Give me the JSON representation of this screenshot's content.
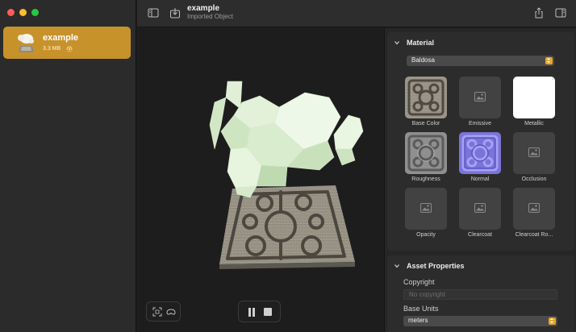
{
  "window": {
    "traffic_lights": [
      "close",
      "minimize",
      "zoom"
    ]
  },
  "sidebar": {
    "items": [
      {
        "name": "example",
        "size": "3.3 MB",
        "icon": "model-thumbnail-icon",
        "selected": true,
        "accent": "#c8922b"
      }
    ]
  },
  "toolbar": {
    "title": "example",
    "subtitle": "Imported Object",
    "icons": [
      "sidebar-toggle-icon",
      "import-icon",
      "share-icon",
      "inspector-toggle-icon"
    ]
  },
  "viewport": {
    "controls": [
      "frame-object-icon",
      "ar-headset-icon"
    ],
    "playback": [
      "pause-icon",
      "stop-icon"
    ]
  },
  "inspector": {
    "material": {
      "title": "Material",
      "selected_material": "Baldosa",
      "slots": [
        {
          "label": "Base Color",
          "state": "texture-stone"
        },
        {
          "label": "Emissive",
          "state": "empty"
        },
        {
          "label": "Metallic",
          "state": "white"
        },
        {
          "label": "Roughness",
          "state": "texture-gray"
        },
        {
          "label": "Normal",
          "state": "texture-normal"
        },
        {
          "label": "Occlusion",
          "state": "empty"
        },
        {
          "label": "Opacity",
          "state": "empty"
        },
        {
          "label": "Clearcoat",
          "state": "empty"
        },
        {
          "label": "Clearcoat Ro...",
          "state": "empty"
        }
      ]
    },
    "asset_properties": {
      "title": "Asset Properties",
      "copyright_label": "Copyright",
      "copyright_placeholder": "No copyright",
      "base_units_label": "Base Units",
      "base_units_value": "meters"
    }
  },
  "colors": {
    "accent": "#e3a72f",
    "selection": "#c8922b",
    "background": "#1e1e1e"
  }
}
